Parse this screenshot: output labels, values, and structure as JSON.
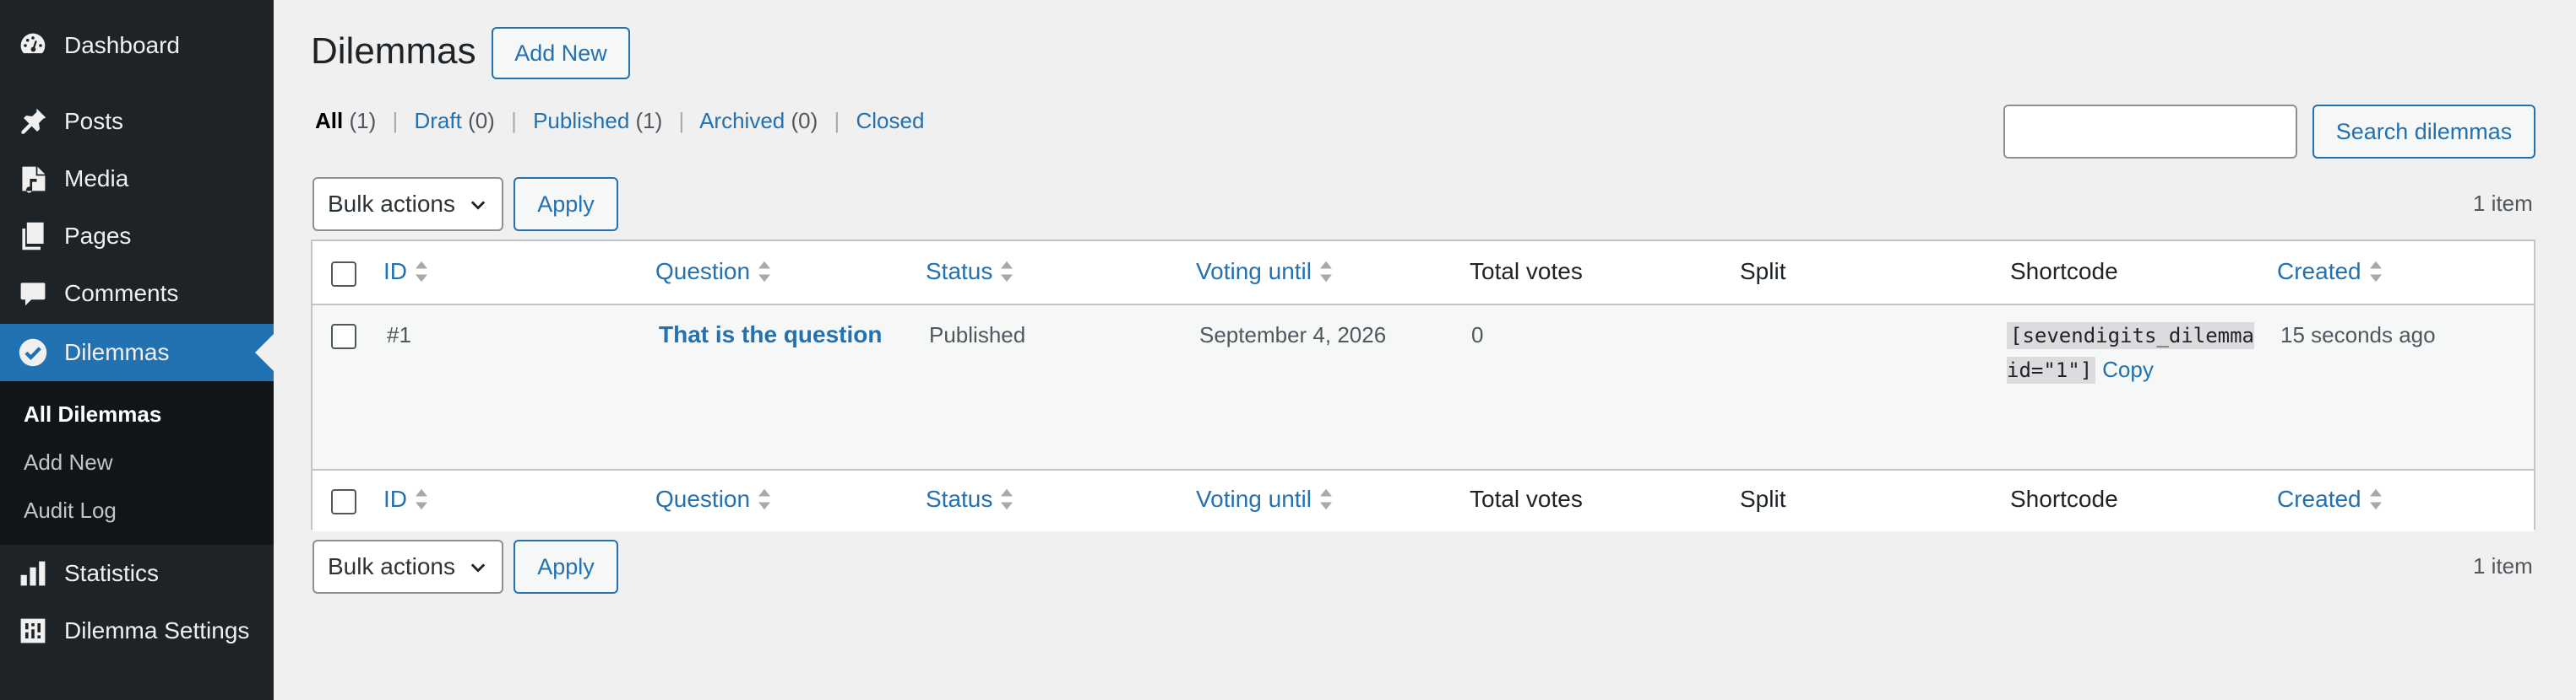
{
  "sidebar": {
    "menu": [
      {
        "label": "Dashboard",
        "icon": "dashboard-icon"
      },
      {
        "label": "Posts",
        "icon": "pin-icon"
      },
      {
        "label": "Media",
        "icon": "media-icon"
      },
      {
        "label": "Pages",
        "icon": "pages-icon"
      },
      {
        "label": "Comments",
        "icon": "comment-icon"
      },
      {
        "label": "Dilemmas",
        "icon": "check-circle-icon",
        "active": true
      },
      {
        "label": "Statistics",
        "icon": "bar-chart-icon"
      },
      {
        "label": "Dilemma Settings",
        "icon": "sliders-icon"
      }
    ],
    "submenu": [
      {
        "label": "All Dilemmas",
        "current": true
      },
      {
        "label": "Add New"
      },
      {
        "label": "Audit Log"
      }
    ]
  },
  "header": {
    "title": "Dilemmas",
    "add_new": "Add New"
  },
  "views": [
    {
      "label": "All",
      "count": "(1)",
      "current": true
    },
    {
      "label": "Draft",
      "count": "(0)"
    },
    {
      "label": "Published",
      "count": "(1)"
    },
    {
      "label": "Archived",
      "count": "(0)"
    },
    {
      "label": "Closed",
      "count": ""
    }
  ],
  "search": {
    "value": "",
    "placeholder": "",
    "button": "Search dilemmas"
  },
  "tablenav": {
    "bulk_actions": "Bulk actions",
    "apply": "Apply",
    "items_count": "1 item"
  },
  "table": {
    "columns": [
      {
        "label": "ID",
        "sortable": true
      },
      {
        "label": "Question",
        "sortable": true
      },
      {
        "label": "Status",
        "sortable": true
      },
      {
        "label": "Voting until",
        "sortable": true
      },
      {
        "label": "Total votes",
        "sortable": false
      },
      {
        "label": "Split",
        "sortable": false
      },
      {
        "label": "Shortcode",
        "sortable": false
      },
      {
        "label": "Created",
        "sortable": true
      }
    ],
    "rows": [
      {
        "id": "#1",
        "question": "That is the question",
        "status": "Published",
        "voting_until": "September 4, 2026",
        "total_votes": "0",
        "split": "",
        "shortcode": "[sevendigits_dilemma id=\"1\"]",
        "copy": "Copy",
        "created": "15 seconds ago"
      }
    ]
  },
  "colors": {
    "sidebar_bg": "#1d2327",
    "submenu_bg": "#101517",
    "accent": "#2271b1",
    "page_bg": "#f0f0f1"
  }
}
